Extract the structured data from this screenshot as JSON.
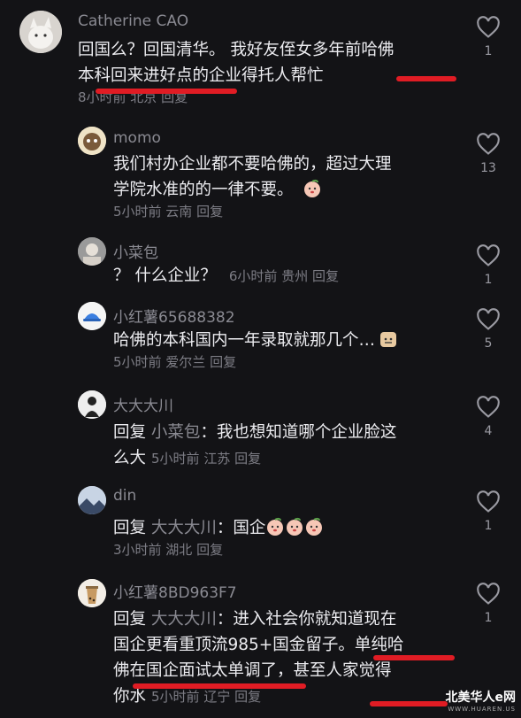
{
  "comments": [
    {
      "author": "Catherine CAO",
      "line1": "回国么？回国清华。 我好友侄女多年前哈佛",
      "line2": "本科回来进好点的企业得托人帮忙",
      "meta": "8小时前 北京 回复",
      "likes": "1"
    },
    {
      "author": "momo",
      "line1": "我们村办企业都不要哈佛的，超过大理",
      "line2": "学院水准的的一律不要。",
      "meta": "5小时前 云南 回复",
      "likes": "13"
    },
    {
      "author": "小菜包",
      "line1": "？ 什么企业？",
      "meta": "6小时前 贵州 回复",
      "likes": "1"
    },
    {
      "author": "小红薯65688382",
      "line1": "哈佛的本科国内一年录取就那几个…",
      "meta": "5小时前 爱尔兰 回复",
      "likes": "5"
    },
    {
      "author": "大大大川",
      "reply_prefix": "回复",
      "reply_target": "小菜包",
      "line1": "：我也想知道哪个企业脸这",
      "line2": "么大",
      "meta": "5小时前 江苏 回复",
      "likes": "4"
    },
    {
      "author": "din",
      "reply_prefix": "回复",
      "reply_target": "大大大川",
      "line1": "：国企",
      "meta": "3小时前 湖北 回复",
      "likes": "1"
    },
    {
      "author": "小红薯8BD963F7",
      "reply_prefix": "回复",
      "reply_target": "大大大川",
      "line1": "：进入社会你就知道现在",
      "line2": "国企更看重顶流985+国金留子。单纯哈",
      "line3": "佛在国企面试太单调了，甚至人家觉得",
      "line4": "你水",
      "meta": "5小时前 辽宁 回复",
      "likes": "1"
    }
  ],
  "icons": {
    "like": "heart-outline-icon",
    "emoji_peach": "peach-face-emoji",
    "emoji_face": "face-emoji"
  },
  "colors": {
    "background": "#131316",
    "highlight": "#e01c24"
  },
  "watermark": {
    "text": "北美华人e网",
    "sub": "WWW.HUAREN.US"
  }
}
